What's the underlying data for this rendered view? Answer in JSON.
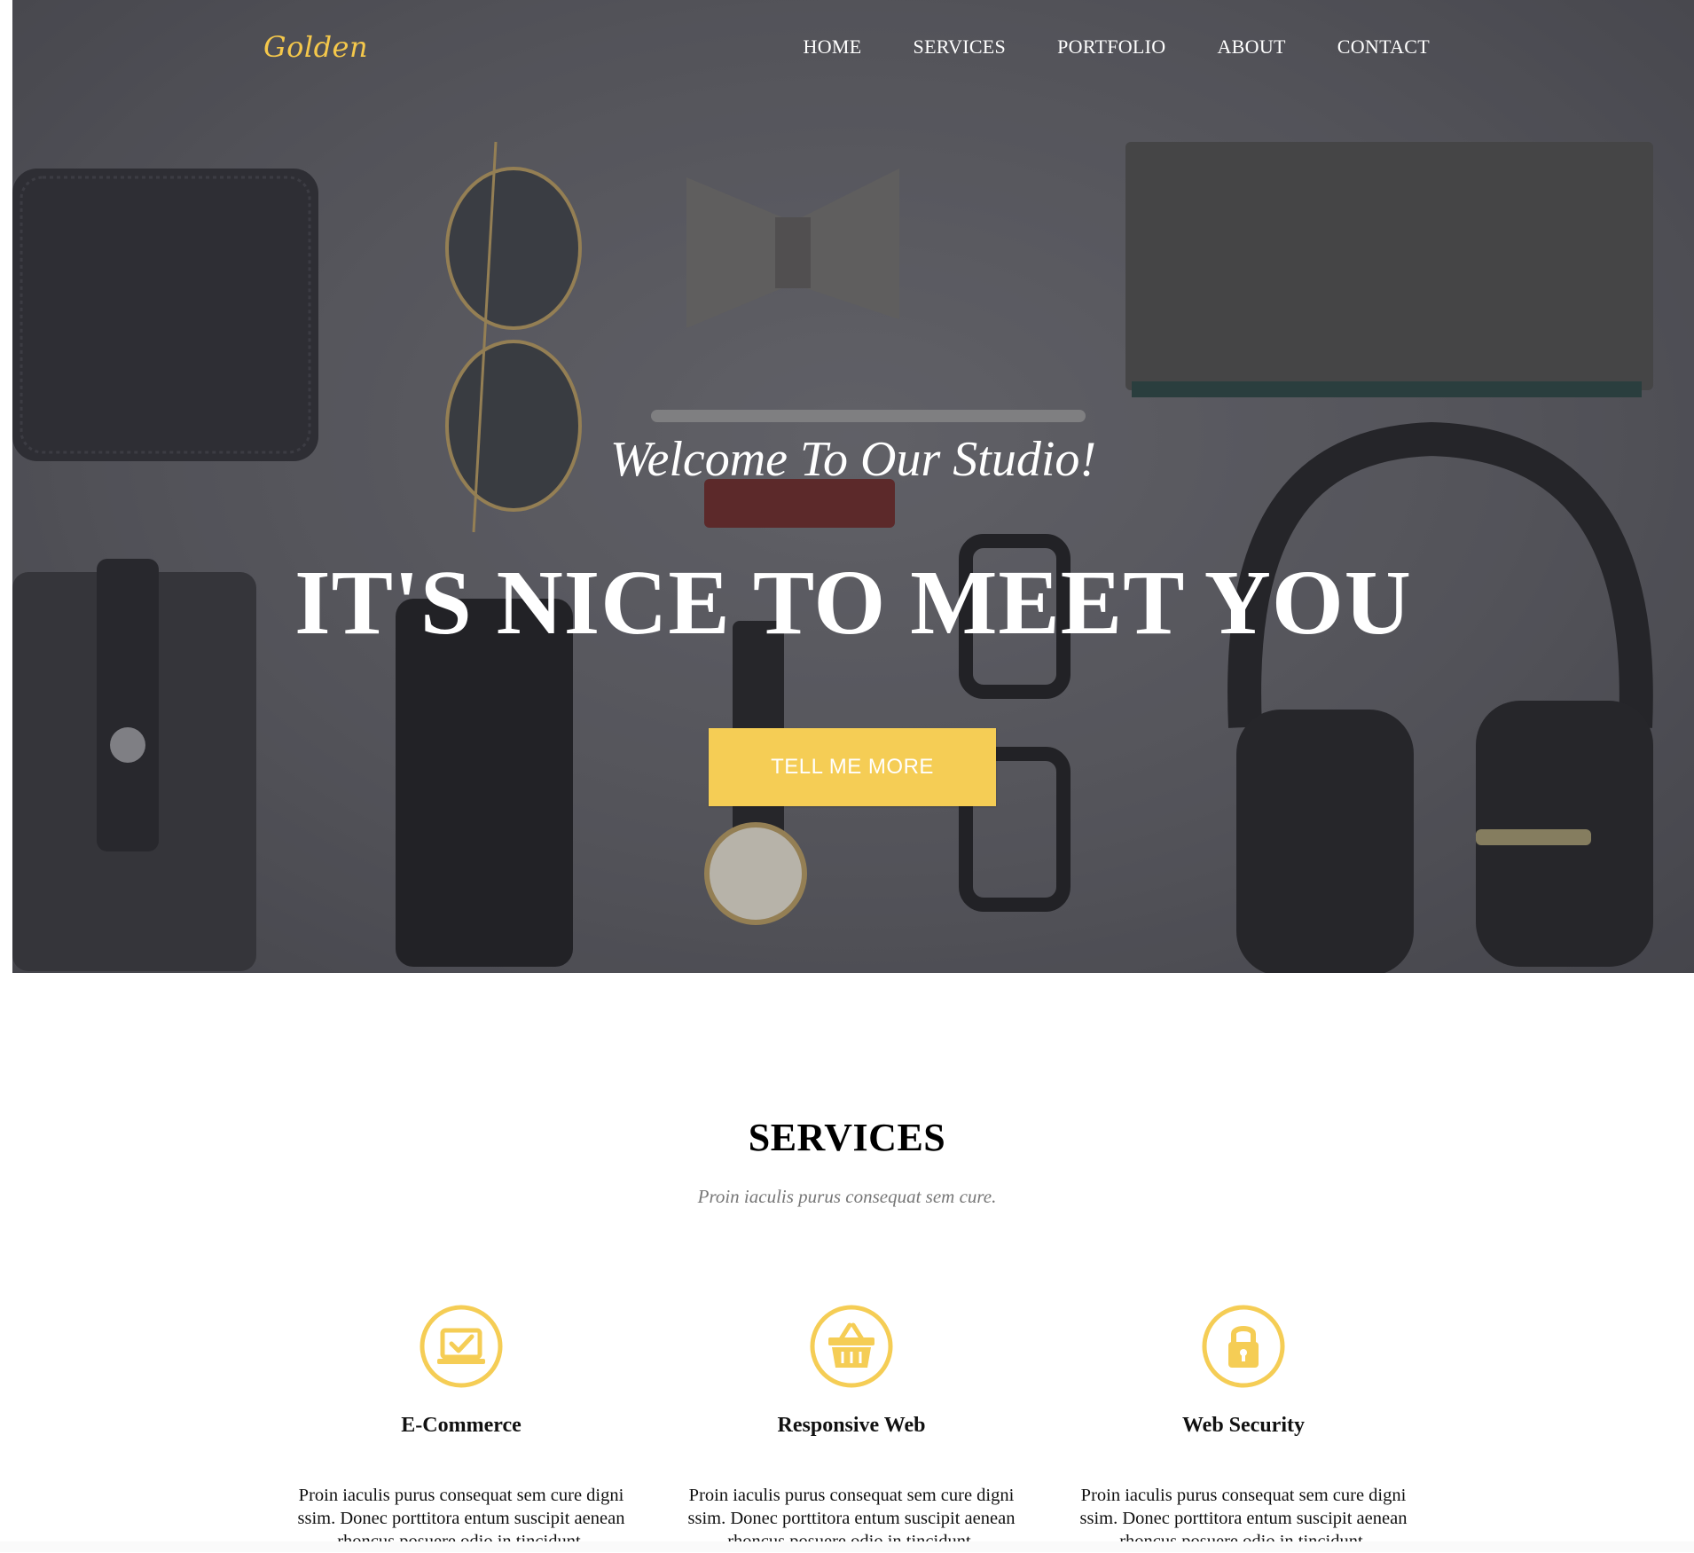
{
  "nav": {
    "logo": "Golden",
    "items": [
      "HOME",
      "SERVICES",
      "PORTFOLIO",
      "ABOUT",
      "CONTACT"
    ]
  },
  "hero": {
    "welcome": "Welcome To Our Studio!",
    "headline": "IT'S NICE TO MEET YOU",
    "cta_label": "TELL ME MORE"
  },
  "services": {
    "title": "SERVICES",
    "subtitle": "Proin iaculis purus consequat sem cure.",
    "items": [
      {
        "icon": "laptop-check-icon",
        "name": "E-Commerce",
        "desc": "Proin iaculis purus consequat sem cure digni ssim. Donec porttitora entum suscipit aenean rhoncus posuere odio in tincidunt."
      },
      {
        "icon": "shopping-basket-icon",
        "name": "Responsive Web",
        "desc": "Proin iaculis purus consequat sem cure digni ssim. Donec porttitora entum suscipit aenean rhoncus posuere odio in tincidunt."
      },
      {
        "icon": "lock-icon",
        "name": "Web Security",
        "desc": "Proin iaculis purus consequat sem cure digni ssim. Donec porttitora entum suscipit aenean rhoncus posuere odio in tincidunt."
      }
    ]
  },
  "colors": {
    "accent": "#f5cd55",
    "hero_bg": "#5e5e64"
  }
}
